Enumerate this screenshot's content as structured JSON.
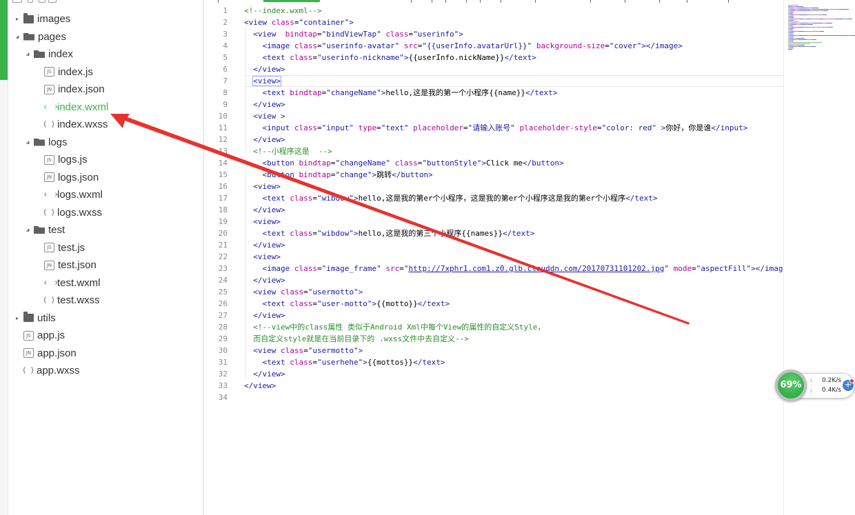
{
  "file_tree": [
    {
      "label": "images",
      "type": "folder",
      "expanded": false,
      "depth": 0
    },
    {
      "label": "pages",
      "type": "folder",
      "expanded": true,
      "depth": 0
    },
    {
      "label": "index",
      "type": "folder",
      "expanded": true,
      "depth": 1
    },
    {
      "label": "index.js",
      "type": "js",
      "depth": 2
    },
    {
      "label": "index.json",
      "type": "json",
      "depth": 2
    },
    {
      "label": "index.wxml",
      "type": "wxml",
      "depth": 2,
      "active": true
    },
    {
      "label": "index.wxss",
      "type": "wxss",
      "depth": 2
    },
    {
      "label": "logs",
      "type": "folder",
      "expanded": true,
      "depth": 1
    },
    {
      "label": "logs.js",
      "type": "js",
      "depth": 2
    },
    {
      "label": "logs.json",
      "type": "json",
      "depth": 2
    },
    {
      "label": "logs.wxml",
      "type": "wxml",
      "depth": 2
    },
    {
      "label": "logs.wxss",
      "type": "wxss",
      "depth": 2
    },
    {
      "label": "test",
      "type": "folder",
      "expanded": true,
      "depth": 1
    },
    {
      "label": "test.js",
      "type": "js",
      "depth": 2
    },
    {
      "label": "test.json",
      "type": "json",
      "depth": 2
    },
    {
      "label": "test.wxml",
      "type": "wxml",
      "depth": 2
    },
    {
      "label": "test.wxss",
      "type": "wxss",
      "depth": 2
    },
    {
      "label": "utils",
      "type": "folder",
      "expanded": false,
      "depth": 0
    },
    {
      "label": "app.js",
      "type": "js",
      "depth": 0
    },
    {
      "label": "app.json",
      "type": "json",
      "depth": 0
    },
    {
      "label": "app.wxss",
      "type": "wxss",
      "depth": 0
    }
  ],
  "file_badges": {
    "js": "JS",
    "json": "JN",
    "wxml": "<>",
    "wxss": "{}"
  },
  "editor": {
    "current_line": 7,
    "lines": [
      [
        [
          "cm",
          "<!--index.wxml-->"
        ]
      ],
      [
        [
          "tg",
          "<view "
        ],
        [
          "at",
          "class"
        ],
        [
          "tx",
          "="
        ],
        [
          "st",
          "\"container\""
        ],
        [
          "tg",
          ">"
        ]
      ],
      [
        [
          "tx",
          "  "
        ],
        [
          "tg",
          "<view  "
        ],
        [
          "at",
          "bindtap"
        ],
        [
          "tx",
          "="
        ],
        [
          "st",
          "\"bindViewTap\""
        ],
        [
          "tx",
          " "
        ],
        [
          "at",
          "class"
        ],
        [
          "tx",
          "="
        ],
        [
          "st",
          "\"userinfo\""
        ],
        [
          "tg",
          ">"
        ]
      ],
      [
        [
          "tx",
          "    "
        ],
        [
          "tg",
          "<image "
        ],
        [
          "at",
          "class"
        ],
        [
          "tx",
          "="
        ],
        [
          "st",
          "\"userinfo-avatar\""
        ],
        [
          "tx",
          " "
        ],
        [
          "at",
          "src"
        ],
        [
          "tx",
          "="
        ],
        [
          "st",
          "\"{{userInfo.avatarUrl}}\""
        ],
        [
          "tx",
          " "
        ],
        [
          "at",
          "background-size"
        ],
        [
          "tx",
          "="
        ],
        [
          "st",
          "\"cover\""
        ],
        [
          "tg",
          "></image>"
        ]
      ],
      [
        [
          "tx",
          "    "
        ],
        [
          "tg",
          "<text "
        ],
        [
          "at",
          "class"
        ],
        [
          "tx",
          "="
        ],
        [
          "st",
          "\"userinfo-nickname\""
        ],
        [
          "tg",
          ">"
        ],
        [
          "tx",
          "{{userInfo.nickName}}"
        ],
        [
          "tg",
          "</text>"
        ]
      ],
      [
        [
          "tx",
          "  "
        ],
        [
          "tg",
          "</view>"
        ]
      ],
      [
        [
          "tx",
          "  "
        ],
        [
          "tgb",
          "<view>"
        ]
      ],
      [
        [
          "tx",
          "    "
        ],
        [
          "tg",
          "<text "
        ],
        [
          "at",
          "bindtap"
        ],
        [
          "tx",
          "="
        ],
        [
          "st",
          "\"changeName\""
        ],
        [
          "tg",
          ">"
        ],
        [
          "tx",
          "hello,这是我的第一个小程序{{name}}"
        ],
        [
          "tg",
          "</text>"
        ]
      ],
      [
        [
          "tx",
          "  "
        ],
        [
          "tg",
          "</view>"
        ]
      ],
      [
        [
          "tx",
          "  "
        ],
        [
          "tg",
          "<view >"
        ]
      ],
      [
        [
          "tx",
          "    "
        ],
        [
          "tg",
          "<input "
        ],
        [
          "at",
          "class"
        ],
        [
          "tx",
          "="
        ],
        [
          "st",
          "\"input\""
        ],
        [
          "tx",
          " "
        ],
        [
          "at",
          "type"
        ],
        [
          "tx",
          "="
        ],
        [
          "st",
          "\"text\""
        ],
        [
          "tx",
          " "
        ],
        [
          "at",
          "placeholder"
        ],
        [
          "tx",
          "="
        ],
        [
          "st",
          "\"请输入账号\""
        ],
        [
          "tx",
          " "
        ],
        [
          "at",
          "placeholder-style"
        ],
        [
          "tx",
          "="
        ],
        [
          "st",
          "\"color: red\""
        ],
        [
          "tx",
          " "
        ],
        [
          "tg",
          ">"
        ],
        [
          "tx",
          "你好，你是谁"
        ],
        [
          "tg",
          "</input>"
        ]
      ],
      [
        [
          "tx",
          "  "
        ],
        [
          "tg",
          "</view>"
        ]
      ],
      [
        [
          "tx",
          "  "
        ],
        [
          "cm",
          "<!--小程序这是  -->"
        ]
      ],
      [
        [
          "tx",
          "    "
        ],
        [
          "tg",
          "<button "
        ],
        [
          "at",
          "bindtap"
        ],
        [
          "tx",
          "="
        ],
        [
          "st",
          "\"changeName\""
        ],
        [
          "tx",
          " "
        ],
        [
          "at",
          "class"
        ],
        [
          "tx",
          "="
        ],
        [
          "st",
          "\"buttonStyle\""
        ],
        [
          "tg",
          ">"
        ],
        [
          "tx",
          "Click me"
        ],
        [
          "tg",
          "</button>"
        ]
      ],
      [
        [
          "tx",
          "    "
        ],
        [
          "tg",
          "<button "
        ],
        [
          "at",
          "bindtap"
        ],
        [
          "tx",
          "="
        ],
        [
          "st",
          "\"change\""
        ],
        [
          "tg",
          ">"
        ],
        [
          "tx",
          "跳转"
        ],
        [
          "tg",
          "</button>"
        ]
      ],
      [
        [
          "tx",
          "  "
        ],
        [
          "tg",
          "<view>"
        ]
      ],
      [
        [
          "tx",
          "    "
        ],
        [
          "tg",
          "<text "
        ],
        [
          "at",
          "class"
        ],
        [
          "tx",
          "="
        ],
        [
          "st",
          "\"wibdow\""
        ],
        [
          "tg",
          ">"
        ],
        [
          "tx",
          "hello,这是我的第er个小程序，这是我的第er个小程序这是我的第er个小程序"
        ],
        [
          "tg",
          "</text>"
        ]
      ],
      [
        [
          "tx",
          "  "
        ],
        [
          "tg",
          "</view>"
        ]
      ],
      [
        [
          "tx",
          "  "
        ],
        [
          "tg",
          "<view>"
        ]
      ],
      [
        [
          "tx",
          "    "
        ],
        [
          "tg",
          "<text "
        ],
        [
          "at",
          "class"
        ],
        [
          "tx",
          "="
        ],
        [
          "st",
          "\"wibdow\""
        ],
        [
          "tg",
          ">"
        ],
        [
          "tx",
          "hello,这是我的第三个小程序{{names}}"
        ],
        [
          "tg",
          "</text>"
        ]
      ],
      [
        [
          "tx",
          "  "
        ],
        [
          "tg",
          "</view>"
        ]
      ],
      [
        [
          "tx",
          "  "
        ],
        [
          "tg",
          "<view>"
        ]
      ],
      [
        [
          "tx",
          "    "
        ],
        [
          "tg",
          "<image "
        ],
        [
          "at",
          "class"
        ],
        [
          "tx",
          "="
        ],
        [
          "st",
          "\"image_frame\""
        ],
        [
          "tx",
          " "
        ],
        [
          "at",
          "src"
        ],
        [
          "tx",
          "="
        ],
        [
          "st",
          "\""
        ],
        [
          "stu",
          "http://7xphr1.com1.z0.glb.clouddn.com/20170731101202.jpg"
        ],
        [
          "st",
          "\""
        ],
        [
          "tx",
          " "
        ],
        [
          "at",
          "mode"
        ],
        [
          "tx",
          "="
        ],
        [
          "st",
          "\"aspectFill\""
        ],
        [
          "tg",
          "></image>"
        ]
      ],
      [
        [
          "tx",
          "  "
        ],
        [
          "tg",
          "</view>"
        ]
      ],
      [
        [
          "tx",
          "  "
        ],
        [
          "tg",
          "<view "
        ],
        [
          "at",
          "class"
        ],
        [
          "tx",
          "="
        ],
        [
          "st",
          "\"usermotto\""
        ],
        [
          "tg",
          ">"
        ]
      ],
      [
        [
          "tx",
          "    "
        ],
        [
          "tg",
          "<text "
        ],
        [
          "at",
          "class"
        ],
        [
          "tx",
          "="
        ],
        [
          "st",
          "\"user-motto\""
        ],
        [
          "tg",
          ">"
        ],
        [
          "tx",
          "{{motto}}"
        ],
        [
          "tg",
          "</text>"
        ]
      ],
      [
        [
          "tx",
          "  "
        ],
        [
          "tg",
          "</view>"
        ]
      ],
      [
        [
          "tx",
          "  "
        ],
        [
          "cm",
          "<!--view中的class属性 类似于Android Xml中每个View的属性的自定义Style，"
        ]
      ],
      [
        [
          "cm",
          "  而自定义style就是在当前目录下的 .wxss文件中去自定义-->"
        ]
      ],
      [
        [
          "tx",
          "  "
        ],
        [
          "tg",
          "<view "
        ],
        [
          "at",
          "class"
        ],
        [
          "tx",
          "="
        ],
        [
          "st",
          "\"usermotto\""
        ],
        [
          "tg",
          ">"
        ]
      ],
      [
        [
          "tx",
          "    "
        ],
        [
          "tg",
          "<text "
        ],
        [
          "at",
          "class"
        ],
        [
          "tx",
          "="
        ],
        [
          "st",
          "\"userhehe\""
        ],
        [
          "tg",
          ">"
        ],
        [
          "tx",
          "{{mottos}}"
        ],
        [
          "tg",
          "</text>"
        ]
      ],
      [
        [
          "tx",
          "  "
        ],
        [
          "tg",
          "</view>"
        ]
      ],
      [
        [
          "tg",
          "</view>"
        ]
      ],
      []
    ]
  },
  "speed_widget": {
    "percent": "69%",
    "upload": "0.2K/s",
    "download": "0.4K/s",
    "add_symbol": "+",
    "up_symbol": "↑",
    "down_symbol": "↓"
  },
  "colors": {
    "accent": "#3cb34a",
    "arrow": "#e8322e"
  }
}
